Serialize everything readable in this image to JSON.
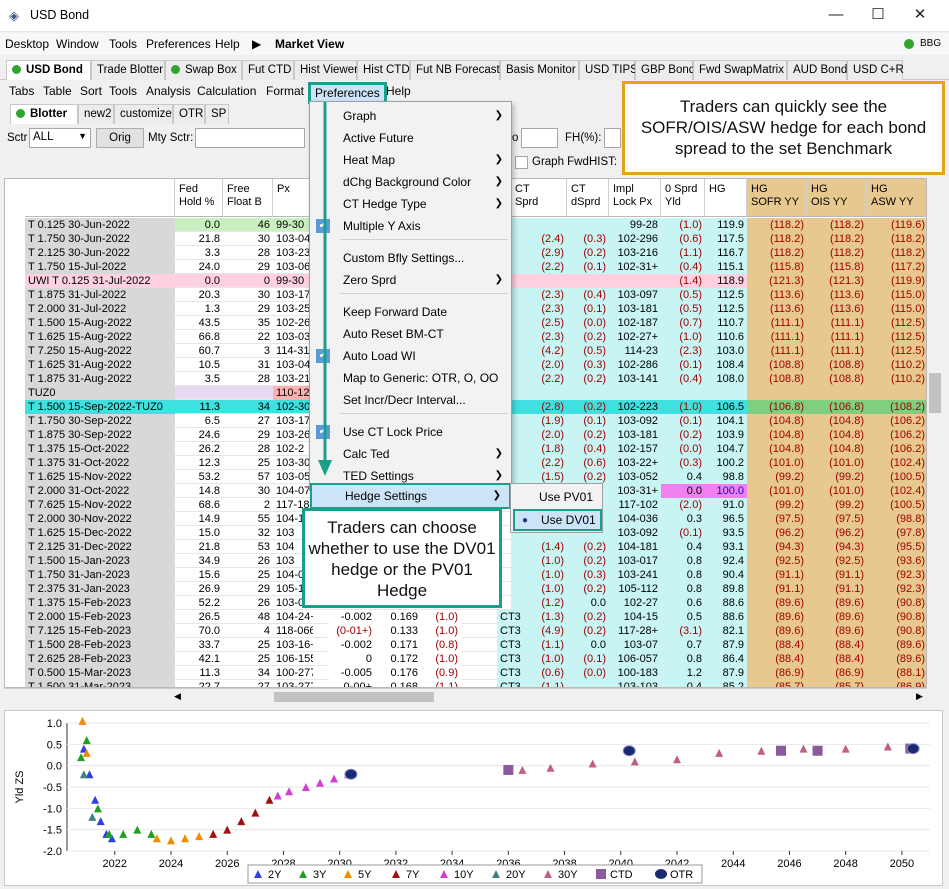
{
  "window": {
    "title": "USD Bond",
    "minimize": "—",
    "maximize": "☐",
    "close": "✕"
  },
  "menubar": {
    "items": [
      "Desktop",
      "Window",
      "Tools",
      "Preferences",
      "Help"
    ],
    "arrow": "▶",
    "market_view": "Market View",
    "bbg": "BBG"
  },
  "main_tabs": [
    "USD Bond",
    "Trade Blotter",
    "Swap Box",
    "Fut CTD",
    "Hist Viewer",
    "Hist CTD",
    "Fut NB Forecast",
    "Basis Monitor",
    "USD TIPS",
    "GBP Bond",
    "Fwd SwapMatrix",
    "AUD Bond",
    "USD C+R"
  ],
  "menubar2": {
    "items": [
      "Tabs",
      "Table",
      "Sort",
      "Tools",
      "Analysis",
      "Calculation",
      "Format",
      "Preferences",
      "Help"
    ]
  },
  "sub_tabs": [
    "Blotter",
    "new2",
    "customize",
    "OTR",
    "SP"
  ],
  "toolbar": {
    "sctr_label": "Sctr",
    "sctr_value": "ALL",
    "orig_button": "Orig",
    "mty_sctr_label": "Mty Sctr:",
    "o_label": "o",
    "fh_label": "FH(%):",
    "graph_fwd_label": "Graph Fwd",
    "hist_label": "HIST:"
  },
  "columns": {
    "fed_hold": "Fed\nHold %",
    "free_float": "Free\nFloat B",
    "px": "Px",
    "ct_sprd": "CT\nSprd",
    "ct_dsprd": "CT\ndSprd",
    "impl_lock": "Impl\nLock Px",
    "zero_sprd": "0 Sprd\nYld",
    "hg": "HG",
    "hg_sofr": "HG\nSOFR YY",
    "hg_ois": "HG\nOIS YY",
    "hg_asw": "HG\nASW YY"
  },
  "rows": [
    [
      "T 0.125 30-Jun-2022",
      "0.0",
      "46",
      "99-30",
      "",
      "",
      "99-28",
      "(1.0)",
      "119.9",
      "(118.2)",
      "(118.2)",
      "(119.6)"
    ],
    [
      "T 1.750 30-Jun-2022",
      "21.8",
      "30",
      "103-04",
      "(2.4)",
      "(0.3)",
      "102-296",
      "(0.6)",
      "117.5",
      "(118.2)",
      "(118.2)",
      "(118.2)"
    ],
    [
      "T 2.125 30-Jun-2022",
      "3.3",
      "28",
      "103-23",
      "(2.9)",
      "(0.2)",
      "103-216",
      "(1.1)",
      "116.7",
      "(118.2)",
      "(118.2)",
      "(118.2)"
    ],
    [
      "T 1.750 15-Jul-2022",
      "24.0",
      "29",
      "103-06",
      "(2.2)",
      "(0.1)",
      "102-31+",
      "(0.4)",
      "115.1",
      "(115.8)",
      "(115.8)",
      "(117.2)"
    ],
    [
      "UWI T 0.125 31-Jul-2022",
      "0.0",
      "0",
      "99-30",
      "",
      "",
      "",
      "(1.4)",
      "118.9",
      "(121.3)",
      "(121.3)",
      "(119.9)"
    ],
    [
      "T 1.875 31-Jul-2022",
      "20.3",
      "30",
      "103-17",
      "(2.3)",
      "(0.4)",
      "103-097",
      "(0.5)",
      "112.5",
      "(113.6)",
      "(113.6)",
      "(115.0)"
    ],
    [
      "T 2.000 31-Jul-2022",
      "1.3",
      "29",
      "103-25",
      "(2.3)",
      "(0.1)",
      "103-181",
      "(0.5)",
      "112.5",
      "(113.6)",
      "(113.6)",
      "(115.0)"
    ],
    [
      "T 1.500 15-Aug-2022",
      "43.5",
      "35",
      "102-26",
      "(2.5)",
      "(0.0)",
      "102-187",
      "(0.7)",
      "110.7",
      "(111.1)",
      "(111.1)",
      "(112.5)"
    ],
    [
      "T 1.625 15-Aug-2022",
      "66.8",
      "22",
      "103-03",
      "(2.3)",
      "(0.2)",
      "102-27+",
      "(1.0)",
      "110.6",
      "(111.1)",
      "(111.1)",
      "(112.5)"
    ],
    [
      "T 7.250 15-Aug-2022",
      "60.7",
      "3",
      "114-31",
      "(4.2)",
      "(0.5)",
      "114-23",
      "(2.3)",
      "103.0",
      "(111.1)",
      "(111.1)",
      "(112.5)"
    ],
    [
      "T 1.625 31-Aug-2022",
      "10.5",
      "31",
      "103-04",
      "(2.0)",
      "(0.3)",
      "102-286",
      "(0.1)",
      "108.4",
      "(108.8)",
      "(108.8)",
      "(110.2)"
    ],
    [
      "T 1.875 31-Aug-2022",
      "3.5",
      "28",
      "103-21",
      "(2.2)",
      "(0.2)",
      "103-141",
      "(0.4)",
      "108.0",
      "(108.8)",
      "(108.8)",
      "(110.2)"
    ],
    [
      "TUZ0",
      "",
      "",
      "110-12",
      "",
      "",
      "",
      "",
      "",
      "",
      "",
      ""
    ],
    [
      "T 1.500 15-Sep-2022-TUZ0",
      "11.3",
      "34",
      "102-30",
      "(2.8)",
      "(0.2)",
      "102-223",
      "(1.0)",
      "106.5",
      "(106.8)",
      "(106.8)",
      "(108.2)"
    ],
    [
      "T 1.750 30-Sep-2022",
      "6.5",
      "27",
      "103-17",
      "(1.9)",
      "(0.1)",
      "103-092",
      "(0.1)",
      "104.1",
      "(104.8)",
      "(104.8)",
      "(106.2)"
    ],
    [
      "T 1.875 30-Sep-2022",
      "24.6",
      "29",
      "103-26",
      "(2.0)",
      "(0.2)",
      "103-181",
      "(0.2)",
      "103.9",
      "(104.8)",
      "(104.8)",
      "(106.2)"
    ],
    [
      "T 1.375 15-Oct-2022",
      "26.2",
      "28",
      "102-2",
      "(1.8)",
      "(0.4)",
      "102-157",
      "(0.0)",
      "104.7",
      "(104.8)",
      "(104.8)",
      "(106.2)"
    ],
    [
      "T 1.375 31-Oct-2022",
      "12.3",
      "25",
      "103-30",
      "(2.2)",
      "(0.6)",
      "103-22+",
      "(0.3)",
      "100.2",
      "(101.0)",
      "(101.0)",
      "(102.4)"
    ],
    [
      "T 1.625 15-Nov-2022",
      "53.2",
      "57",
      "103-05",
      "(1.5)",
      "(0.2)",
      "103-052",
      "0.4",
      "98.8",
      "(99.2)",
      "(99.2)",
      "(100.5)"
    ],
    [
      "T 2.000 31-Oct-2022",
      "14.8",
      "30",
      "104-07",
      "",
      "",
      "103-31+",
      "0.0",
      "100.0",
      "(101.0)",
      "(101.0)",
      "(102.4)"
    ],
    [
      "T 7.625 15-Nov-2022",
      "68.6",
      "2",
      "117-18",
      "",
      "",
      "117-102",
      "(2.0)",
      "91.0",
      "(99.2)",
      "(99.2)",
      "(100.5)"
    ],
    [
      "T 2.000 30-Nov-2022",
      "14.9",
      "55",
      "104-1",
      "",
      "",
      "104-036",
      "0.3",
      "96.5",
      "(97.5)",
      "(97.5)",
      "(98.8)"
    ],
    [
      "T 1.625 15-Dec-2022",
      "15.0",
      "32",
      "103",
      "",
      "",
      "103-092",
      "(0.1)",
      "93.5",
      "(96.2)",
      "(96.2)",
      "(97.8)"
    ],
    [
      "T 2.125 31-Dec-2022",
      "21.8",
      "53",
      "104",
      "(1.4)",
      "(0.2)",
      "104-181",
      "0.4",
      "93.1",
      "(94.3)",
      "(94.3)",
      "(95.5)"
    ],
    [
      "T 1.500 15-Jan-2023",
      "34.9",
      "26",
      "103",
      "(1.0)",
      "(0.2)",
      "103-017",
      "0.8",
      "92.4",
      "(92.5)",
      "(92.5)",
      "(93.6)"
    ],
    [
      "T 1.750 31-Jan-2023",
      "15.6",
      "25",
      "104-0",
      "(1.0)",
      "(0.3)",
      "103-241",
      "0.8",
      "90.4",
      "(91.1)",
      "(91.1)",
      "(92.3)"
    ],
    [
      "T 2.375 31-Jan-2023",
      "26.9",
      "29",
      "105-1",
      "(1.0)",
      "(0.2)",
      "105-112",
      "0.8",
      "89.8",
      "(91.1)",
      "(91.1)",
      "(92.3)"
    ],
    [
      "T 1.375 15-Feb-2023",
      "52.2",
      "26",
      "103-0",
      "(1.2)",
      "0.0",
      "102-27",
      "0.6",
      "88.6",
      "(89.6)",
      "(89.6)",
      "(90.8)"
    ],
    [
      "T 2.000 15-Feb-2023",
      "26.5",
      "48",
      "104-24+",
      "(1.3)",
      "(0.2)",
      "104-15",
      "0.5",
      "88.6",
      "(89.6)",
      "(89.6)",
      "(90.8)"
    ],
    [
      "T 7.125 15-Feb-2023",
      "70.0",
      "4",
      "118-066",
      "(4.9)",
      "(0.2)",
      "117-28+",
      "(3.1)",
      "82.1",
      "(89.6)",
      "(89.6)",
      "(90.8)"
    ],
    [
      "T 1.500 28-Feb-2023",
      "33.7",
      "25",
      "103-16+",
      "(1.1)",
      "0.0",
      "103-07",
      "0.7",
      "87.9",
      "(88.4)",
      "(88.4)",
      "(89.6)"
    ],
    [
      "T 2.625 28-Feb-2023",
      "42.1",
      "25",
      "106-155",
      "(1.0)",
      "(0.1)",
      "106-057",
      "0.8",
      "86.4",
      "(88.4)",
      "(88.4)",
      "(89.6)"
    ],
    [
      "T 0.500 15-Mar-2023",
      "11.3",
      "34",
      "100-277",
      "(0.6)",
      "(0.0)",
      "100-183",
      "1.2",
      "87.9",
      "(86.9)",
      "(86.9)",
      "(88.1)"
    ],
    [
      "T 1.500 31-Mar-2023",
      "22.7",
      "27",
      "103-277",
      "(1.1)",
      "",
      "103-103",
      "0.4",
      "85.2",
      "(85.7)",
      "(85.7)",
      "(86.9)"
    ]
  ],
  "extra_cols": [
    [
      "-0.002",
      "0.169",
      "(1.0)",
      "CT3"
    ],
    [
      "(0-01+)",
      "0.133",
      "(1.0)",
      "CT3"
    ],
    [
      "-0.002",
      "0.171",
      "(0.8)",
      "CT3"
    ],
    [
      "0",
      "0.172",
      "(1.0)",
      "CT3"
    ],
    [
      "-0.005",
      "0.176",
      "(0.9)",
      "CT3"
    ],
    [
      "0-00+",
      "0.168",
      "(1.1)",
      "CT3"
    ]
  ],
  "preferences_menu": {
    "items": [
      "Graph",
      "Active Future",
      "Heat Map",
      "dChg Background Color",
      "CT Hedge Type",
      "Multiple Y Axis",
      "Custom Bfly Settings...",
      "Zero Sprd",
      "Keep Forward Date",
      "Auto Reset BM-CT",
      "Auto Load WI",
      "Map to Generic: OTR, O, OO",
      "Set Incr/Decr Interval...",
      "Use CT Lock Price",
      "Calc Ted",
      "TED Settings",
      "Hedge Settings"
    ]
  },
  "hedge_submenu": {
    "items": [
      "Use PV01",
      "Use DV01"
    ]
  },
  "callouts": {
    "top_right": "Traders can quickly see the SOFR/OIS/ASW hedge for each bond spread to the set Benchmark",
    "bottom": "Traders can choose whether to use the DV01 hedge or the PV01 Hedge"
  },
  "chart": {
    "ylabel": "Yld ZS",
    "yticks": [
      "1.0",
      "0.5",
      "0.0",
      "-0.5",
      "-1.0",
      "-1.5",
      "-2.0"
    ],
    "xticks": [
      "2022",
      "2024",
      "2026",
      "2028",
      "2030",
      "2032",
      "2034",
      "2036",
      "2038",
      "2040",
      "2042",
      "2044",
      "2046",
      "2048",
      "2050"
    ],
    "legend": [
      "2Y",
      "3Y",
      "5Y",
      "7Y",
      "10Y",
      "20Y",
      "30Y",
      "CTD",
      "OTR"
    ]
  },
  "chart_data": {
    "type": "scatter",
    "xlabel": "",
    "ylabel": "Yld ZS",
    "ylim": [
      -2.0,
      1.0
    ],
    "xlim": [
      2020.3,
      2051
    ],
    "series": [
      {
        "name": "2Y",
        "color": "#3040e0",
        "points": [
          [
            2020.9,
            0.4
          ],
          [
            2021.1,
            -0.2
          ],
          [
            2021.3,
            -0.8
          ],
          [
            2021.5,
            -1.3
          ],
          [
            2021.7,
            -1.6
          ],
          [
            2021.9,
            -1.7
          ]
        ]
      },
      {
        "name": "3Y",
        "color": "#20a020",
        "points": [
          [
            2020.8,
            0.2
          ],
          [
            2021.0,
            0.6
          ],
          [
            2021.4,
            -1.0
          ],
          [
            2021.8,
            -1.6
          ],
          [
            2022.3,
            -1.6
          ],
          [
            2022.8,
            -1.5
          ],
          [
            2023.3,
            -1.6
          ]
        ]
      },
      {
        "name": "5Y",
        "color": "#f08c00",
        "points": [
          [
            2020.85,
            1.05
          ],
          [
            2021.0,
            0.3
          ],
          [
            2023.5,
            -1.7
          ],
          [
            2024.0,
            -1.75
          ],
          [
            2024.5,
            -1.7
          ],
          [
            2025.0,
            -1.65
          ]
        ]
      },
      {
        "name": "7Y",
        "color": "#a01010",
        "points": [
          [
            2025.5,
            -1.6
          ],
          [
            2026.0,
            -1.5
          ],
          [
            2026.5,
            -1.3
          ],
          [
            2027.0,
            -1.1
          ],
          [
            2027.5,
            -0.8
          ]
        ]
      },
      {
        "name": "10Y",
        "color": "#d040d0",
        "points": [
          [
            2027.8,
            -0.7
          ],
          [
            2028.2,
            -0.6
          ],
          [
            2028.8,
            -0.5
          ],
          [
            2029.3,
            -0.4
          ],
          [
            2029.8,
            -0.3
          ],
          [
            2030.3,
            -0.2
          ]
        ]
      },
      {
        "name": "20Y",
        "color": "#408080",
        "points": [
          [
            2020.9,
            -0.2
          ],
          [
            2021.2,
            -1.2
          ]
        ]
      },
      {
        "name": "30Y",
        "color": "#c06080",
        "points": [
          [
            2036.5,
            -0.1
          ],
          [
            2037.5,
            -0.05
          ],
          [
            2039.0,
            0.05
          ],
          [
            2040.5,
            0.1
          ],
          [
            2042.0,
            0.15
          ],
          [
            2043.5,
            0.3
          ],
          [
            2045.0,
            0.35
          ],
          [
            2046.5,
            0.4
          ],
          [
            2048.0,
            0.4
          ],
          [
            2049.5,
            0.45
          ]
        ]
      },
      {
        "name": "CTD",
        "color": "#8a5a9a",
        "points": [
          [
            2036.0,
            -0.1
          ],
          [
            2045.7,
            0.35
          ],
          [
            2047.0,
            0.35
          ],
          [
            2050.3,
            0.4
          ]
        ]
      },
      {
        "name": "OTR",
        "color": "#1a2a70",
        "points": [
          [
            2030.4,
            -0.2
          ],
          [
            2040.3,
            0.35
          ],
          [
            2050.4,
            0.4
          ]
        ]
      }
    ]
  }
}
